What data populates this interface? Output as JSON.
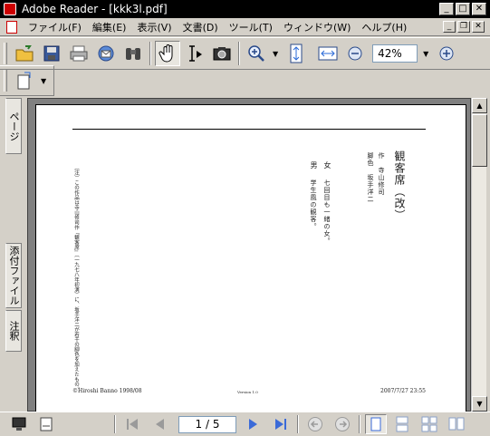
{
  "window": {
    "title": "Adobe Reader - [kkk3l.pdf]"
  },
  "menu": {
    "items": [
      "ファイル(F)",
      "編集(E)",
      "表示(V)",
      "文書(D)",
      "ツール(T)",
      "ウィンドウ(W)",
      "ヘルプ(H)"
    ]
  },
  "toolbar": {
    "zoom_value": "42%"
  },
  "side_tabs": {
    "pages": "ページ",
    "attachments": "添付ファイル",
    "comments": "注釈"
  },
  "navigation": {
    "page_indicator": "1 / 5"
  },
  "document": {
    "title": "観客席（改）",
    "author_line": "作　寺山修司",
    "adaptation_line": "脚色　坂手洋二",
    "char_woman": "女",
    "char_woman_desc": "七回目も一緒の女。",
    "char_man": "男",
    "char_man_desc": "学生風の観客。",
    "note": "〔注〕この作品は寺山修司作『観客席』（一九七八年初演）に、坂手洋二が若干の脚色を加えたもの。",
    "footer_left": "©Hiroshi Banno 1998/08",
    "footer_center": "Version 1.0",
    "footer_right": "2007/7/27 23:55"
  }
}
